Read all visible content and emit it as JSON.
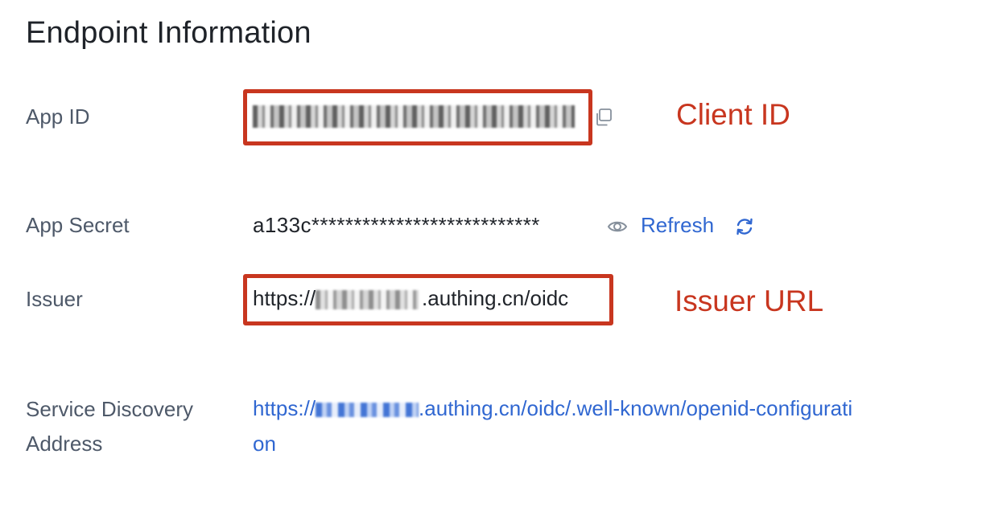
{
  "section": {
    "title": "Endpoint Information"
  },
  "fields": {
    "app_id": {
      "label": "App ID"
    },
    "app_secret": {
      "label": "App Secret",
      "value": "a133c***************************",
      "refresh_label": "Refresh"
    },
    "issuer": {
      "label": "Issuer",
      "prefix": "https://",
      "suffix": ".authing.cn/oidc"
    },
    "discovery": {
      "label_line1": "Service Discovery",
      "label_line2": "Address",
      "prefix": "https://",
      "suffix_line1": ".authing.cn/oidc/.well-known/openid-configurati",
      "suffix_line2": "on"
    }
  },
  "annotations": {
    "client_id": "Client ID",
    "issuer_url": "Issuer URL"
  },
  "colors": {
    "annotation_red": "#c8361f",
    "link_blue": "#3067d1",
    "label_gray": "#4e5969"
  },
  "icons": {
    "copy": "copy-icon",
    "eye": "eye-icon",
    "refresh": "refresh-icon"
  }
}
